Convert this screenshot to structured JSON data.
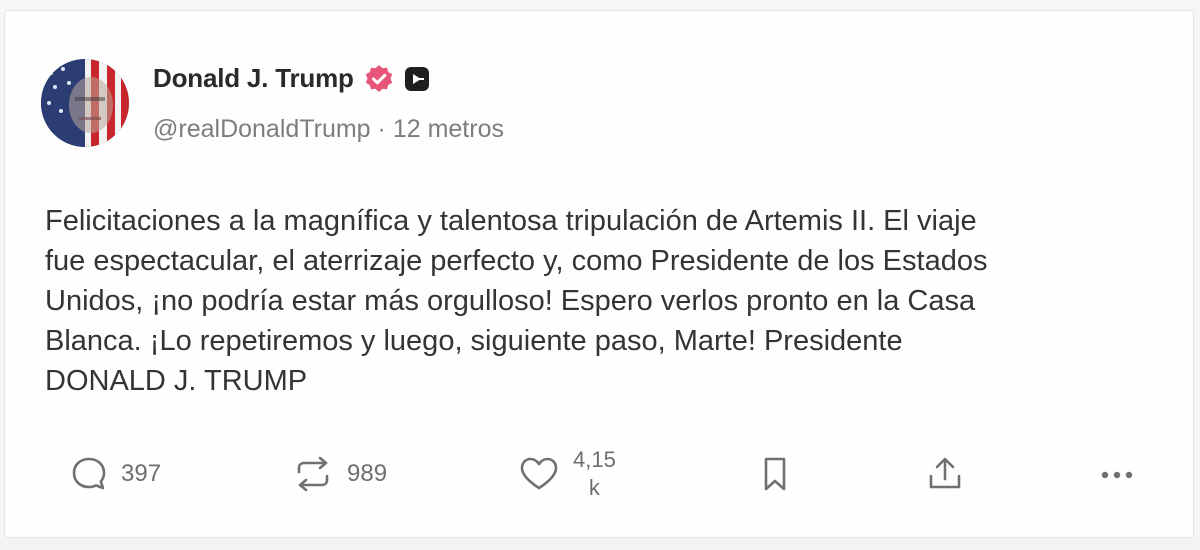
{
  "post": {
    "author_name": "Donald J. Trump",
    "handle": "@realDonaldTrump",
    "separator": "·",
    "time": "12 metros",
    "text": "Felicitaciones a la magnífica y talentosa tripulación de Artemis II. El viaje\nfue espectacular, el aterrizaje perfecto y, como Presidente de los Estados\nUnidos, ¡no podría estar más orgulloso! Espero verlos pronto en la Casa\nBlanca. ¡Lo repetiremos y luego, siguiente paso, Marte! Presidente\nDONALD J. TRUMP"
  },
  "badges": {
    "verified_icon": "verified-badge-icon",
    "verified_color": "#e8557a",
    "extra_icon": "plus-square-icon"
  },
  "actions": {
    "reply_count": "397",
    "repost_count": "989",
    "like_count_top": "4,15",
    "like_count_bottom": "k",
    "reply_icon": "comment-icon",
    "repost_icon": "repost-icon",
    "like_icon": "heart-icon",
    "bookmark_icon": "bookmark-icon",
    "share_icon": "share-icon",
    "more_icon": "more-icon"
  }
}
